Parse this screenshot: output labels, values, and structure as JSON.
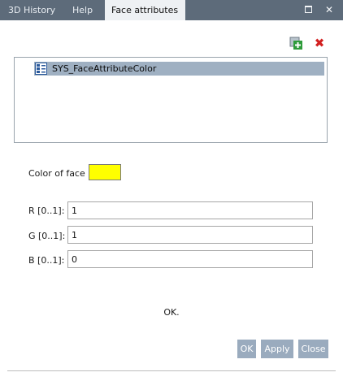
{
  "tabs": [
    {
      "label": "3D History",
      "active": false
    },
    {
      "label": "Help",
      "active": false
    },
    {
      "label": "Face attributes",
      "active": true
    }
  ],
  "window_controls": {
    "restore_icon": "restore-window-icon",
    "close_icon": "close-icon",
    "close_glyph": "✕"
  },
  "toolbar": {
    "add_icon": "add-attribute-icon",
    "delete_icon": "delete-icon",
    "delete_glyph": "✖",
    "add_color": "#2e9b3a",
    "delete_color": "#d22020"
  },
  "attribute_list": {
    "items": [
      {
        "label": "SYS_FaceAttributeColor",
        "selected": true,
        "icon": "attribute-type-icon"
      }
    ],
    "selection_color": "#9fb0c2"
  },
  "color": {
    "label": "Color of face",
    "swatch_color": "#ffff00"
  },
  "fields": [
    {
      "label": "R [0..1]:",
      "value": "1"
    },
    {
      "label": "G [0..1]:",
      "value": "1"
    },
    {
      "label": "B [0..1]:",
      "value": "0"
    }
  ],
  "status_text": "OK.",
  "buttons": {
    "ok": "OK",
    "apply": "Apply",
    "close": "Close",
    "color": "#9aabbe"
  },
  "colors": {
    "tabbar": "#5d6b7a",
    "active_tab": "#eef1f4"
  }
}
